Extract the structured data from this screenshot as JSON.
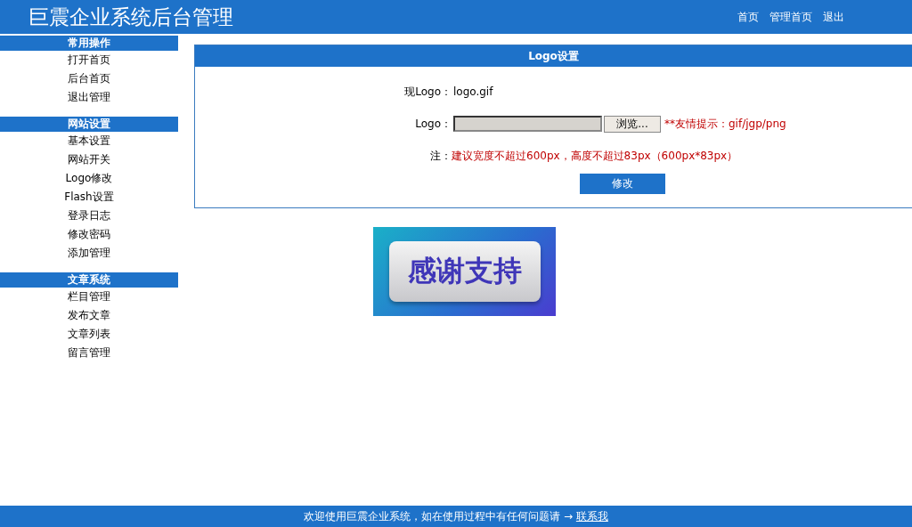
{
  "header": {
    "title": "巨震企业系统后台管理",
    "links": [
      "首页",
      "管理首页",
      "退出"
    ]
  },
  "sidebar": {
    "sections": [
      {
        "title": "常用操作",
        "items": [
          "打开首页",
          "后台首页",
          "退出管理"
        ]
      },
      {
        "title": "网站设置",
        "items": [
          "基本设置",
          "网站开关",
          "Logo修改",
          "Flash设置",
          "登录日志",
          "修改密码",
          "添加管理"
        ]
      },
      {
        "title": "文章系统",
        "items": [
          "栏目管理",
          "发布文章",
          "文章列表",
          "留言管理"
        ]
      }
    ]
  },
  "panel": {
    "title": "Logo设置",
    "current_label": "现Logo：",
    "current_value": "logo.gif",
    "upload_label": "Logo：",
    "browse_button": "浏览...",
    "upload_hint": "**友情提示：gif/jgp/png",
    "note_label": "注：",
    "note_text": "建议宽度不超过600px，高度不超过83px（600px*83px）",
    "submit_button": "修改"
  },
  "logo_preview": {
    "text": "感谢支持"
  },
  "footer": {
    "text": "欢迎使用巨震企业系统，如在使用过程中有任何问题请 → ",
    "link": "联系我"
  }
}
